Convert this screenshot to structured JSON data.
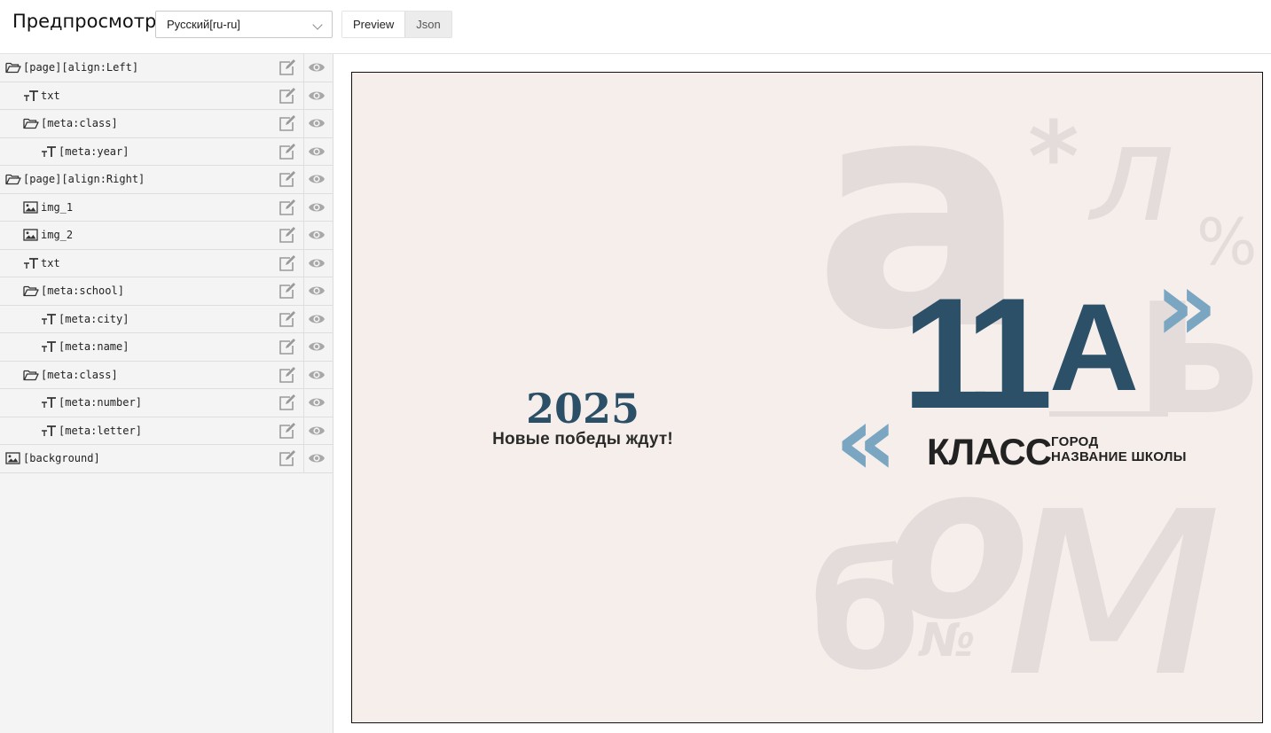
{
  "header": {
    "title": "Предпросмотр",
    "language_select": {
      "value": "Русский[ru-ru]"
    },
    "tabs": [
      {
        "label": "Preview",
        "active": true
      },
      {
        "label": "Json",
        "active": false
      }
    ]
  },
  "tree": [
    {
      "label": "[page][align:Left]",
      "type": "folder",
      "level": 0
    },
    {
      "label": "txt",
      "type": "text",
      "level": 1
    },
    {
      "label": "[meta:class]",
      "type": "folder",
      "level": 1
    },
    {
      "label": "[meta:year]",
      "type": "text",
      "level": 2
    },
    {
      "label": "[page][align:Right]",
      "type": "folder",
      "level": 0
    },
    {
      "label": "img_1",
      "type": "image",
      "level": 1
    },
    {
      "label": "img_2",
      "type": "image",
      "level": 1
    },
    {
      "label": "txt",
      "type": "text",
      "level": 1
    },
    {
      "label": "[meta:school]",
      "type": "folder",
      "level": 1
    },
    {
      "label": "[meta:city]",
      "type": "text",
      "level": 2
    },
    {
      "label": "[meta:name]",
      "type": "text",
      "level": 2
    },
    {
      "label": "[meta:class]",
      "type": "folder",
      "level": 1
    },
    {
      "label": "[meta:number]",
      "type": "text",
      "level": 2
    },
    {
      "label": "[meta:letter]",
      "type": "text",
      "level": 2
    },
    {
      "label": "[background]",
      "type": "image",
      "level": 0
    }
  ],
  "icons": {
    "folder": "folder-open-icon",
    "text": "text-type-icon",
    "image": "image-icon",
    "edit": "edit-icon",
    "visibility": "eye-icon"
  },
  "preview": {
    "left_page": {
      "year": "2025",
      "tagline": "Новые победы ждут!"
    },
    "right_page": {
      "class_number": "11",
      "class_letter": "А",
      "class_word": "КЛАСС",
      "city": "ГОРОД",
      "school_name": "НАЗВАНИЕ ШКОЛЫ",
      "quote_open": "«",
      "quote_close": "»"
    },
    "background_glyphs": [
      "а",
      "*",
      "л",
      "%",
      "ь",
      "м",
      "о",
      "б",
      "№"
    ]
  },
  "colors": {
    "accent_dark_blue": "#2b5068",
    "accent_light_blue": "#7aa6c2",
    "page_background": "#f5eeeb",
    "glyph_color": "#e3dcda"
  }
}
